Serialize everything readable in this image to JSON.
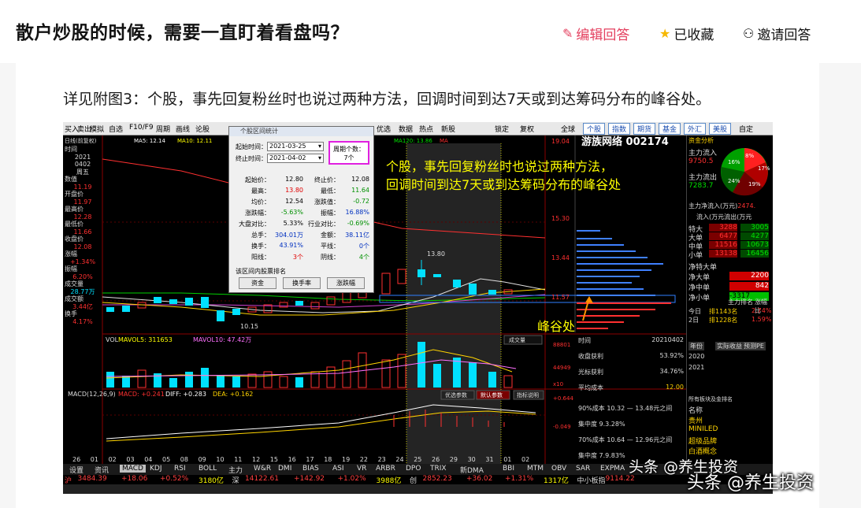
{
  "question": {
    "title": "散户炒股的时候，需要一直盯着看盘吗？"
  },
  "actions": {
    "edit": "编辑回答",
    "favorite": "已收藏",
    "invite": "邀请回答"
  },
  "answer": {
    "text": "详见附图3：个股，事先回复粉丝时也说过两种方法，回调时间到达7天或到达筹码分布的峰谷处。"
  },
  "screenshot": {
    "menu": [
      "买入",
      "卖出",
      "模拟",
      "自选",
      "F10/F9",
      "周期",
      "画线",
      "论股",
      "优选",
      "数据",
      "热点",
      "新股",
      "锁定",
      "复权",
      "全球",
      "个股",
      "指数",
      "期货",
      "基金",
      "外汇",
      "美股",
      "自定"
    ],
    "stock_header": "游族网络 002174",
    "chart_top_left": "日线(前复权)",
    "ma_labels": [
      "MA5: 12.14",
      "MA10: 12.11",
      "MA120: 13.86",
      "MA"
    ],
    "annotation_main": [
      "个股，事先回复粉丝时也说过两种方法，",
      "回调时间到达7天或到达筹码分布的峰谷处"
    ],
    "annotation_valley": "峰谷处",
    "price_marks": [
      "13.80",
      "10.15"
    ],
    "right_axis": [
      "19.04",
      "15.30",
      "13.44",
      "11.57"
    ],
    "left_panel": [
      {
        "label": "时间",
        "value": "2021"
      },
      {
        "label": "",
        "value": "0402"
      },
      {
        "label": "",
        "value": "周五"
      },
      {
        "label": "数值",
        "value": "11.19"
      },
      {
        "label": "开盘价",
        "value": "11.97"
      },
      {
        "label": "最高价",
        "value": "12.28"
      },
      {
        "label": "最低价",
        "value": "11.66"
      },
      {
        "label": "收盘价",
        "value": "12.08"
      },
      {
        "label": "涨幅",
        "value": "+1.34%"
      },
      {
        "label": "振幅",
        "value": "6.20%"
      },
      {
        "label": "成交量",
        "value": "28.77万"
      },
      {
        "label": "成交额",
        "value": "3.44亿"
      },
      {
        "label": "换手",
        "value": "4.17%"
      }
    ],
    "dialog": {
      "title": "个股区间统计",
      "start_label": "起始时间：",
      "start": "2021-03-25",
      "end_label": "终止时间：",
      "end": "2021-04-02",
      "period_label": "周期个数：",
      "period": "7个",
      "rows": [
        [
          "起始价：",
          "12.80",
          "终止价：",
          "12.08"
        ],
        [
          "最高：",
          "13.80",
          "最低：",
          "11.64"
        ],
        [
          "均价：",
          "12.54",
          "涨跌值：",
          "-0.72"
        ],
        [
          "涨跌幅：",
          "-5.63%",
          "振幅：",
          "16.88%"
        ],
        [
          "大盘对比：",
          "5.33%",
          "行业对比：",
          "-0.69%"
        ],
        [
          "总手：",
          "304.01万",
          "金额：",
          "38.11亿"
        ],
        [
          "换手：",
          "43.91%",
          "平线：",
          "0个"
        ],
        [
          "阳线：",
          "3个",
          "阴线：",
          "4个"
        ]
      ],
      "section": "该区间内股票排名",
      "buttons": [
        "资金",
        "换手率",
        "涨跌幅"
      ]
    },
    "volume_labels": [
      "VOL",
      "MAVOL5: 311653",
      "MAVOL10: 47.42万"
    ],
    "volume_axis": [
      "88801",
      "44949",
      "x10"
    ],
    "vol_button": "成交量",
    "macd_labels": [
      "MACD(12,26,9)",
      "MACD: +0.241",
      "DIFF: +0.283",
      "DEA: +0.162"
    ],
    "macd_axis": [
      "+0.644",
      "-0.049"
    ],
    "macd_buttons": [
      "优选参数",
      "默认参数",
      "指标说明"
    ],
    "x_axis": [
      "26",
      "01",
      "02",
      "03",
      "04",
      "05",
      "08",
      "09",
      "10",
      "11",
      "12",
      "15",
      "16",
      "17",
      "18",
      "19",
      "22",
      "23",
      "24",
      "25",
      "26",
      "29",
      "30",
      "31",
      "01",
      "02"
    ],
    "bottom_tabs": [
      "设置",
      "资讯",
      "MACD",
      "KDJ",
      "RSI",
      "BOLL",
      "主力",
      "W&R",
      "DMI",
      "BIAS",
      "ASI",
      "VR",
      "ARBR",
      "DPO",
      "TRIX",
      "新DMA",
      "BBI",
      "MTM",
      "OBV",
      "SAR",
      "EXPMA"
    ],
    "ticker": [
      {
        "t": "沪",
        "c": "#ff4040"
      },
      {
        "t": "3484.39",
        "c": "#ff4040"
      },
      {
        "t": "+18.06",
        "c": "#ff4040"
      },
      {
        "t": "+0.52%",
        "c": "#ff4040"
      },
      {
        "t": "3180亿",
        "c": "#ffff00"
      },
      {
        "t": "深",
        "c": "#ddd"
      },
      {
        "t": "14122.61",
        "c": "#ff4040"
      },
      {
        "t": "+142.92",
        "c": "#ff4040"
      },
      {
        "t": "+1.02%",
        "c": "#ff4040"
      },
      {
        "t": "3988亿",
        "c": "#ffff00"
      },
      {
        "t": "创",
        "c": "#ddd"
      },
      {
        "t": "2852.23",
        "c": "#ff4040"
      },
      {
        "t": "+36.02",
        "c": "#ff4040"
      },
      {
        "t": "+1.31%",
        "c": "#ff4040"
      },
      {
        "t": "1317亿",
        "c": "#ffff00"
      },
      {
        "t": "中小板指",
        "c": "#ddd"
      },
      {
        "t": "9114.22",
        "c": "#ff4040"
      }
    ],
    "right": {
      "title": "资金分析",
      "main_in_label": "主力流入",
      "main_in": "9750.5",
      "main_out_label": "主力流出",
      "main_out": "7283.7",
      "pie": [
        "16%",
        "8%",
        "17%",
        "24%",
        "19%"
      ],
      "net_label": "主力净流入(万元)",
      "net_value": "2474.",
      "flow_header": "流入(万元流出(万元",
      "flows": [
        {
          "k": "特大",
          "in": "3288",
          "out": "3005"
        },
        {
          "k": "大单",
          "in": "6477",
          "out": "4277"
        },
        {
          "k": "中单",
          "in": "11516",
          "out": "10673"
        },
        {
          "k": "小单",
          "in": "13138",
          "out": "16456"
        }
      ],
      "nets": [
        {
          "k": "净特大单",
          "v": ""
        },
        {
          "k": "净大单",
          "v": "2200"
        },
        {
          "k": "净中单",
          "v": "842"
        },
        {
          "k": "净小单",
          "v": "-3317"
        }
      ],
      "rank_header": [
        "主力排名",
        "涨幅比"
      ],
      "ranks": [
        {
          "k": "今日",
          "v": "排1143名",
          "p": "2.74%"
        },
        {
          "k": "2日",
          "v": "排1228名",
          "p": "1.59%"
        }
      ],
      "info_tabs": [
        "年份",
        "实际收益",
        "预测PE"
      ],
      "years": [
        "2020",
        "2021"
      ],
      "info_rows": [
        {
          "k": "时间",
          "v": "20210402"
        },
        {
          "k": "收盘获利",
          "v": "53.92%"
        },
        {
          "k": "光标获利",
          "v": "34.76%"
        },
        {
          "k": "平均成本",
          "v": "12.00"
        }
      ],
      "cost_rows": [
        {
          "k": "90%成本",
          "v": "10.32 — 13.48元之间"
        },
        {
          "k": "集中度",
          "v": "9.3.28%"
        },
        {
          "k": "70%成本",
          "v": "10.64 — 12.96元之间"
        },
        {
          "k": "集中度",
          "v": "7.9.83%"
        }
      ],
      "concept_header": "所有板块及金排名",
      "concepts": [
        "名称",
        "贵州",
        "MINILED",
        "超级品牌",
        "白酒概念"
      ]
    }
  },
  "watermark": {
    "small": "头条 @养生投资",
    "big": "头条 @养生投资"
  },
  "colors": {
    "accent": "#e4405f",
    "chart_bg": "#000000",
    "candle_up": "#ff3030",
    "candle_down": "#00e0ff",
    "annotation": "#ffff00"
  }
}
